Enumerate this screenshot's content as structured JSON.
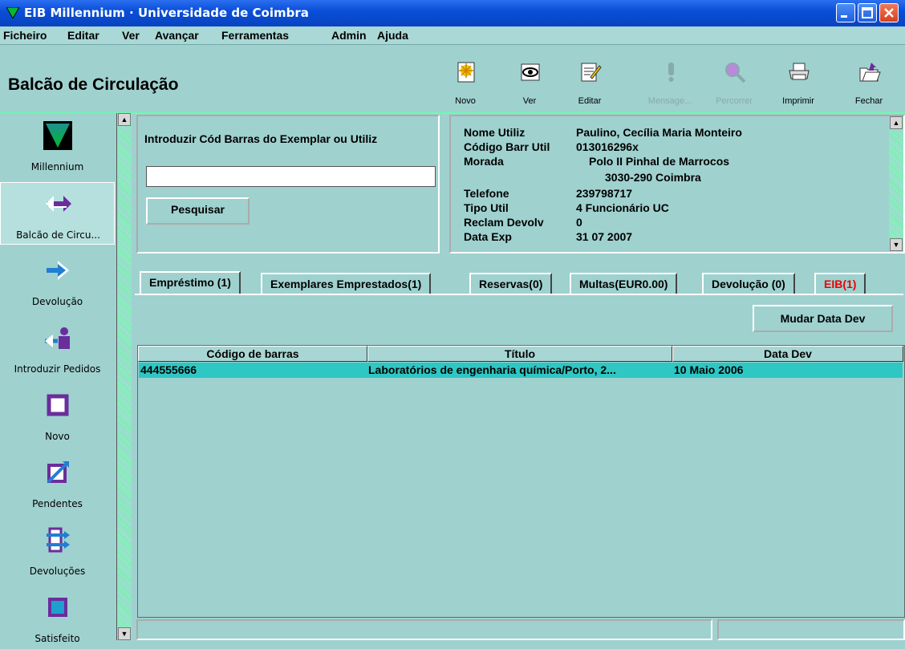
{
  "window": {
    "title": "EIB Millennium · Universidade de Coimbra"
  },
  "menu": [
    "Ficheiro",
    "Editar",
    "Ver",
    "Avançar",
    "Ferramentas",
    "Admin",
    "Ajuda"
  ],
  "header": {
    "title": "Balcão de Circulação"
  },
  "toolbar": [
    {
      "label": "Novo",
      "icon": "new-document-icon",
      "enabled": true
    },
    {
      "label": "Ver",
      "icon": "eye-icon",
      "enabled": true
    },
    {
      "label": "Editar",
      "icon": "edit-icon",
      "enabled": true
    },
    {
      "label": "Mensage...",
      "icon": "exclamation-icon",
      "enabled": false
    },
    {
      "label": "Percorrer",
      "icon": "magnifier-icon",
      "enabled": false
    },
    {
      "label": "Imprimir",
      "icon": "printer-icon",
      "enabled": true
    },
    {
      "label": "Fechar",
      "icon": "close-folder-icon",
      "enabled": true
    }
  ],
  "sidebar": {
    "items": [
      {
        "label": "Millennium",
        "icon": "millennium-logo-icon"
      },
      {
        "label": "Balcão de Circu...",
        "icon": "double-arrow-icon",
        "active": true
      },
      {
        "label": "Devolução",
        "icon": "return-arrow-icon"
      },
      {
        "label": "Introduzir Pedidos",
        "icon": "request-person-icon"
      },
      {
        "label": "Novo",
        "icon": "new-square-icon"
      },
      {
        "label": "Pendentes",
        "icon": "pending-icon"
      },
      {
        "label": "Devoluções",
        "icon": "returns-list-icon"
      },
      {
        "label": "Satisfeito",
        "icon": "satisfied-icon"
      }
    ]
  },
  "search": {
    "label": "Introduzir Cód Barras do Exemplar ou Utiliz",
    "value": "",
    "button": "Pesquisar"
  },
  "user": {
    "fields": [
      {
        "label": "Nome Utiliz",
        "value": "Paulino, Cecília Maria Monteiro"
      },
      {
        "label": "Código Barr Util",
        "value": "013016296x"
      },
      {
        "label": "Morada",
        "value": "Polo II Pinhal de Marrocos"
      },
      {
        "label": "",
        "value": "3030-290 Coimbra"
      },
      {
        "label": "Telefone",
        "value": "239798717"
      },
      {
        "label": "Tipo Util",
        "value": "4 Funcionário UC"
      },
      {
        "label": "Reclam Devolv",
        "value": "0"
      },
      {
        "label": "Data Exp",
        "value": "31 07 2007"
      }
    ]
  },
  "tabs": [
    {
      "label": "Empréstimo (1)",
      "active": true
    },
    {
      "label": "Exemplares Emprestados(1)"
    },
    {
      "label": "Reservas(0)"
    },
    {
      "label": "Multas(EUR0.00)"
    },
    {
      "label": "Devolução (0)"
    },
    {
      "label": "EIB(1)",
      "color": "#e00000"
    }
  ],
  "actions": {
    "change_due_date": "Mudar Data Dev"
  },
  "table": {
    "columns": [
      "Código de barras",
      "Título",
      "Data Dev"
    ],
    "rows": [
      [
        "444555666",
        "Laboratórios de engenharia química/Porto, 2...",
        "10 Maio 2006"
      ]
    ]
  }
}
